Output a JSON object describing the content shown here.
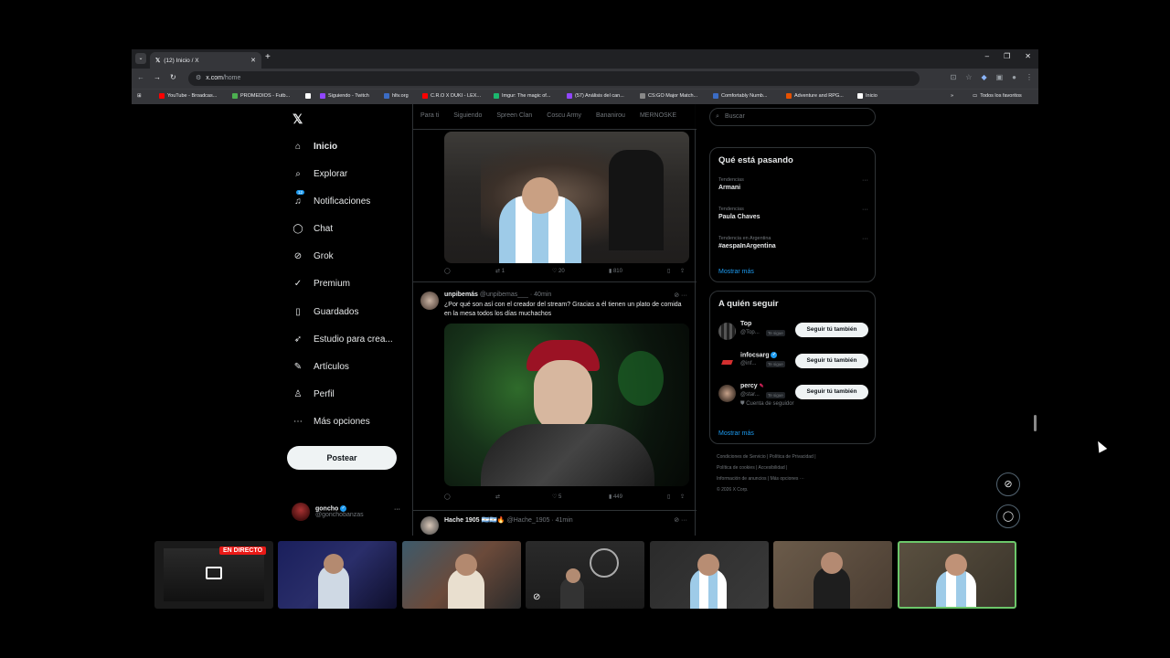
{
  "browser": {
    "tab_title": "(12) Inicio / X",
    "url_host": "x.com",
    "url_path": "/home",
    "bookmarks": [
      {
        "label": "YouTube - Broadcas..."
      },
      {
        "label": "PROMEDIOS - Futb..."
      },
      {
        "label": ""
      },
      {
        "label": "Siguiendo - Twitch"
      },
      {
        "label": "hltv.org"
      },
      {
        "label": "C.R.O X DUKI - LEX..."
      },
      {
        "label": "Imgur: The magic of..."
      },
      {
        "label": "(57) Análisis del can..."
      },
      {
        "label": "CS:GO Major Match..."
      },
      {
        "label": "Comfortably Numb..."
      },
      {
        "label": "Adventure and RPG..."
      },
      {
        "label": "Inicio"
      }
    ],
    "all_bookmarks": "Todos los favoritos"
  },
  "nav": {
    "logo": "𝕏",
    "items": [
      {
        "label": "Inicio",
        "icon": "home-icon"
      },
      {
        "label": "Explorar",
        "icon": "search-icon"
      },
      {
        "label": "Notificaciones",
        "icon": "bell-icon",
        "badge": "12"
      },
      {
        "label": "Chat",
        "icon": "chat-icon"
      },
      {
        "label": "Grok",
        "icon": "grok-icon"
      },
      {
        "label": "Premium",
        "icon": "premium-icon"
      },
      {
        "label": "Guardados",
        "icon": "bookmark-icon"
      },
      {
        "label": "Estudio para crea...",
        "icon": "rocket-icon"
      },
      {
        "label": "Artículos",
        "icon": "article-icon"
      },
      {
        "label": "Perfil",
        "icon": "person-icon"
      },
      {
        "label": "Más opciones",
        "icon": "more-icon"
      }
    ],
    "post_button": "Postear",
    "account": {
      "name": "goncho",
      "handle": "@gonchobanzas"
    }
  },
  "timeline": {
    "tabs": [
      "Para ti",
      "Siguiendo",
      "Spreen Clan",
      "Coscu Army",
      "Bananirou",
      "MERNOSKE"
    ],
    "tweet0": {
      "replies": "",
      "retweets": "1",
      "likes": "20",
      "views": "810"
    },
    "tweet1": {
      "author": "unpibemás",
      "handle": "@unpibemas___",
      "time": "· 40min",
      "text": "¿Por qué son así con el creador del stream? Gracias a él tienen un plato de comida en la mesa todos los días muchachos",
      "replies": "",
      "retweets": "",
      "likes": "5",
      "views": "449"
    },
    "tweet2": {
      "author": "Hache 1905",
      "emoji": "🇦🇷🇦🇷🔥",
      "handle": "@Hache_1905",
      "time": "· 41min"
    }
  },
  "sidebar": {
    "search_placeholder": "Buscar",
    "trends_title": "Qué está pasando",
    "trends": [
      {
        "context": "Tendencias",
        "title": "Armani"
      },
      {
        "context": "Tendencias",
        "title": "Paula Chaves"
      },
      {
        "context": "Tendencia en Argentina",
        "title": "#aespaInArgentina"
      }
    ],
    "show_more": "Mostrar más",
    "follow_title": "A quién seguir",
    "follow": [
      {
        "name": "Top",
        "handle": "@Top...",
        "tag": "Te sigue",
        "button": "Seguir tú también"
      },
      {
        "name": "infocsarg",
        "handle": "@inf...",
        "tag": "Te sigue",
        "button": "Seguir tú también"
      },
      {
        "name": "percy",
        "handle": "@star...",
        "tag": "Te sigue",
        "button": "Seguir tú también",
        "note": "Cuenta de seguidor"
      }
    ],
    "footer": [
      "Condiciones de Servicio",
      "Política de Privacidad",
      "Política de cookies",
      "Accesibilidad",
      "Información de anuncios",
      "Más opciones ···",
      "© 2026 X Corp."
    ]
  },
  "stream_strip": {
    "live_label": "EN DIRECTO"
  },
  "colors": {
    "accent": "#1d9bf0",
    "background": "#000000",
    "live": "#e91916"
  }
}
